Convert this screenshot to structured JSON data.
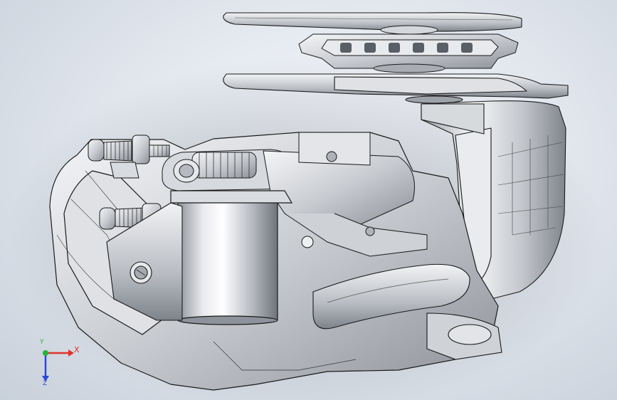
{
  "viewport": {
    "background_center": "#f7f9fc",
    "background_edge": "#c8d0da",
    "model_fill": "#bfc3c9",
    "model_highlight": "#f4f5f7",
    "edge_color": "#1a1a1a"
  },
  "triad": {
    "x_label": "X",
    "y_label": "Y",
    "z_label": "Z",
    "x_color": "#e0322c",
    "y_color": "#27b33a",
    "z_color": "#2c48d6"
  }
}
